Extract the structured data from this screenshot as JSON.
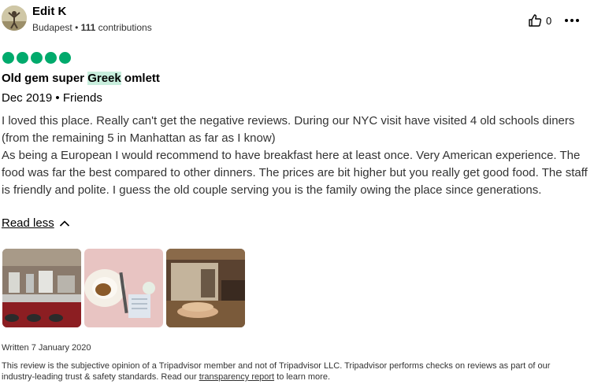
{
  "author": {
    "name": "Edit K",
    "location": "Budapest",
    "contributions_count": "111",
    "contributions_label": "contributions"
  },
  "helpful_votes": "0",
  "rating": 5,
  "review": {
    "title_before": "Old gem super ",
    "title_highlight": "Greek",
    "title_after": " omlett",
    "date": "Dec 2019",
    "trip_type": "Friends",
    "body": "I loved this place. Really can't get the negative reviews. During our NYC visit have visited 4 old schools diners (from the remaining 5 in Manhattan as far as I know)\nAs being a European I would recommend to have breakfast here at least once. Very American experience. The food was far the best compared to other dinners. The prices are bit higher but you really get good food. The staff is friendly and polite. I guess the old couple serving you is the family owing the place since generations.",
    "read_less": "Read less",
    "written": "Written 7 January 2020"
  },
  "disclaimer": {
    "text_before": "This review is the subjective opinion of a Tripadvisor member and not of Tripadvisor LLC. Tripadvisor performs checks on reviews as part of our industry-leading trust & safety standards. Read our ",
    "link": "transparency report",
    "text_after": " to learn more."
  },
  "colors": {
    "rating_bubble": "#00aa6c",
    "highlight": "#c8eedd"
  },
  "icons": {
    "helpful": "thumbs-up-icon",
    "more": "more-options-icon",
    "read_less": "chevron-up-icon"
  }
}
